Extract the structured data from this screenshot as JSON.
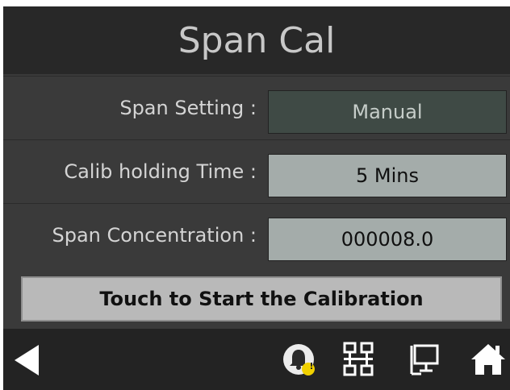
{
  "header": {
    "title": "Span Cal"
  },
  "rows": [
    {
      "label": "Span Setting :",
      "value": "Manual"
    },
    {
      "label": "Calib holding Time :",
      "value": "5 Mins"
    },
    {
      "label": "Span Concentration :",
      "value": "000008.0"
    }
  ],
  "start_button": {
    "label": "Touch to Start the Calibration"
  },
  "footer": {
    "icons": [
      "back-icon",
      "alarm-bell-icon",
      "network-icon",
      "monitor-icon",
      "home-icon"
    ],
    "alarm_badge": "!"
  },
  "colors": {
    "header_bg": "#282828",
    "body_bg": "#3a3a3a",
    "value_dark": "#3f4a45",
    "value_light": "#a4acaa",
    "button_bg": "#b9b9b9",
    "badge": "#f0d000"
  }
}
